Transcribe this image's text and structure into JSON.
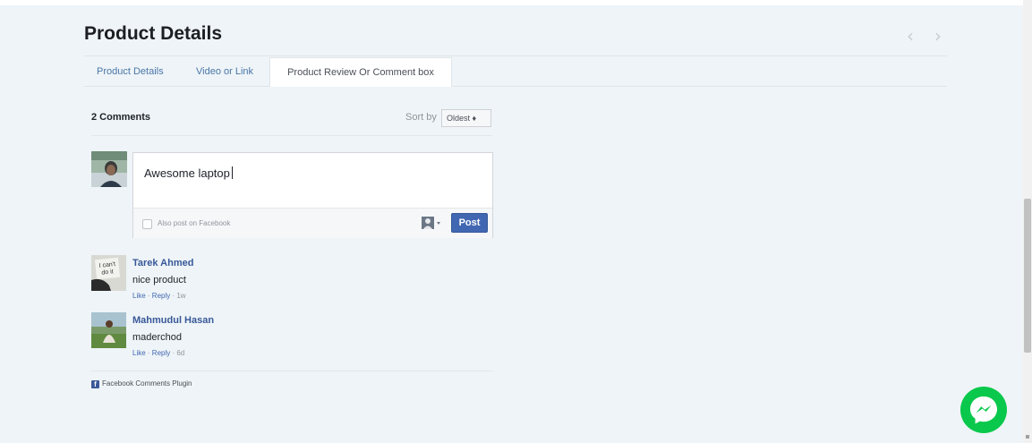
{
  "section": {
    "title": "Product Details"
  },
  "carousel": {
    "prev_icon": "chevron-left-icon",
    "next_icon": "chevron-right-icon"
  },
  "tabs": [
    {
      "label": "Product Details",
      "active": false
    },
    {
      "label": "Video or Link",
      "active": false
    },
    {
      "label": "Product Review Or Comment box",
      "active": true
    }
  ],
  "comments_header": {
    "count_label": "2 Comments",
    "sort_label": "Sort by",
    "sort_value": "Oldest ♦"
  },
  "composer": {
    "input_value": "Awesome laptop",
    "also_post_label": "Also post on Facebook",
    "post_label": "Post"
  },
  "comments": [
    {
      "author": "Tarek Ahmed",
      "text": "nice product",
      "like": "Like",
      "reply": "Reply",
      "age": "1w"
    },
    {
      "author": "Mahmudul Hasan",
      "text": "maderchod",
      "like": "Like",
      "reply": "Reply",
      "age": "6d"
    }
  ],
  "plugin_label": "Facebook Comments Plugin",
  "colors": {
    "background": "#eef4f7",
    "link": "#4267b2",
    "post_button": "#4267b2",
    "messenger": "#09c84b"
  }
}
